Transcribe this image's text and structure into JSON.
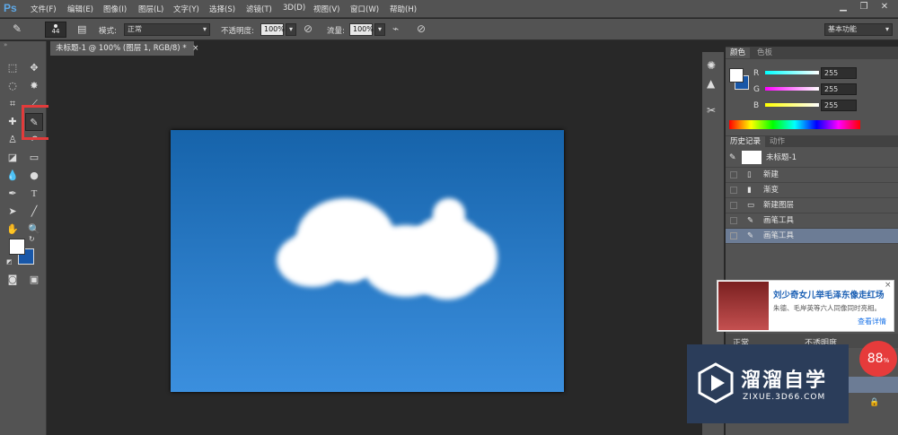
{
  "app": {
    "logo": "Ps"
  },
  "menu": [
    "文件(F)",
    "编辑(E)",
    "图像(I)",
    "图层(L)",
    "文字(Y)",
    "选择(S)",
    "滤镜(T)",
    "3D(D)",
    "视图(V)",
    "窗口(W)",
    "帮助(H)"
  ],
  "window": {
    "minimize": "▁",
    "restore": "❐",
    "close": "✕"
  },
  "options": {
    "brush_size": "44",
    "mode_label": "模式:",
    "mode_value": "正常",
    "opacity_label": "不透明度:",
    "opacity_value": "100%",
    "flow_label": "流量:",
    "flow_value": "100%",
    "workspace": "基本功能"
  },
  "document": {
    "tab_title": "未标题-1 @ 100% (图层 1, RGB/8) *",
    "close": "×"
  },
  "color_panel": {
    "tabs": [
      "颜色",
      "色板"
    ],
    "r_label": "R",
    "g_label": "G",
    "b_label": "B",
    "r": "255",
    "g": "255",
    "b": "255"
  },
  "history_panel": {
    "tabs": [
      "历史记录",
      "动作"
    ],
    "snapshot": "未标题-1",
    "items": [
      "新建",
      "渐变",
      "新建图层",
      "画笔工具",
      "画笔工具"
    ]
  },
  "layers_panel": {
    "blend": "正常",
    "opacity_label": "不透明度"
  },
  "ad": {
    "title": "刘少奇女儿举毛泽东像走红场",
    "subtitle": "朱德、毛岸英等六人同像同时亮相。",
    "link": "查看详情",
    "close": "×"
  },
  "brand": {
    "name": "溜溜自学",
    "url": "ZIXUE.3D66.COM"
  },
  "badge": {
    "value": "88",
    "unit": "%"
  },
  "colors": {
    "accent": "#e23b3b",
    "canvas_top": "#1663aa",
    "canvas_bottom": "#3b8fde"
  }
}
